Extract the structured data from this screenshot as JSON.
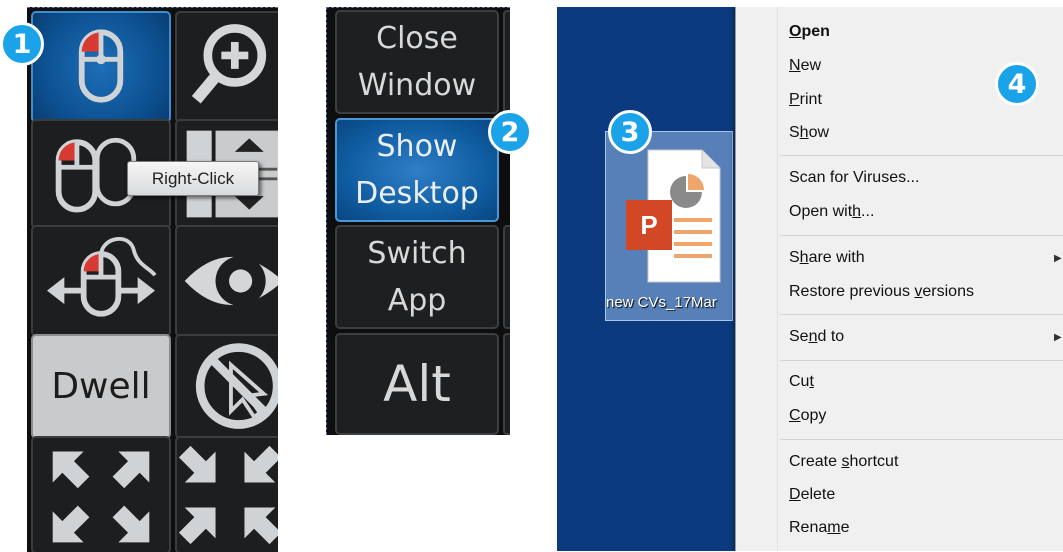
{
  "panel1": {
    "tooltip": "Right-Click",
    "dwell_label": "Dwell",
    "cells": [
      {
        "icon": "left-click-mouse-icon",
        "active": true
      },
      {
        "icon": "zoom-in-icon"
      },
      {
        "icon": "right-click-mouse-icon"
      },
      {
        "icon": "scroll-icon"
      },
      {
        "icon": "drag-mouse-icon"
      },
      {
        "icon": "eye-icon"
      },
      {
        "icon": "dwell-button"
      },
      {
        "icon": "disable-cursor-icon"
      },
      {
        "icon": "expand-arrows-icon"
      },
      {
        "icon": "expand-arrows-icon"
      }
    ]
  },
  "panel2": {
    "buttons": [
      {
        "line1": "Close",
        "line2": "Window"
      },
      {
        "line1": "Show",
        "line2": "Desktop",
        "active": true
      },
      {
        "line1": "Switch",
        "line2": "App"
      },
      {
        "line1": "Alt",
        "line2": ""
      }
    ]
  },
  "panel3": {
    "file_label": "new CVs_17Mar",
    "file_icon": "powerpoint-file-icon",
    "menu": {
      "open": "Open",
      "new": "New",
      "print": "Print",
      "show": "Show",
      "scan": "Scan for Viruses...",
      "open_with": "Open with...",
      "share_with": "Share with",
      "restore": "Restore previous versions",
      "send_to": "Send to",
      "cut": "Cut",
      "copy": "Copy",
      "create_shortcut": "Create shortcut",
      "delete": "Delete",
      "rename": "Rename"
    }
  },
  "badges": [
    "1",
    "2",
    "3",
    "4"
  ],
  "colors": {
    "badge": "#1aa3e8",
    "active_button": "#0f5b9f",
    "desktop": "#0b3a7e",
    "menu_bg": "#f0f0f0"
  }
}
